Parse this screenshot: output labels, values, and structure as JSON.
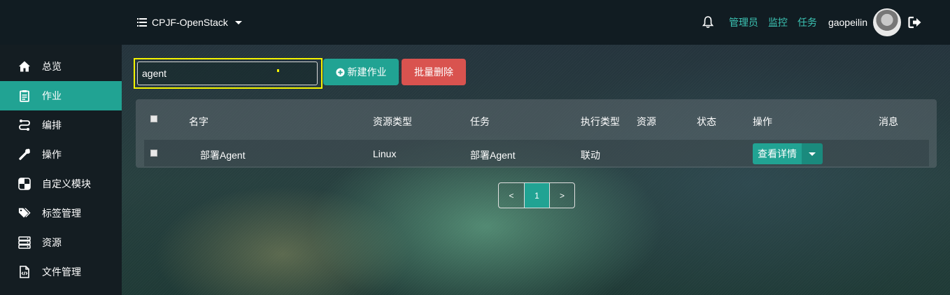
{
  "header": {
    "project_name": "CPJF-OpenStack",
    "links": [
      "管理员",
      "监控",
      "任务"
    ],
    "username": "gaopeilin",
    "accent": "#21a393",
    "link_color": "#3cc4b4"
  },
  "sidebar": {
    "items": [
      {
        "label": "总览",
        "icon": "home-icon"
      },
      {
        "label": "作业",
        "icon": "clipboard-icon",
        "active": true
      },
      {
        "label": "编排",
        "icon": "flow-icon"
      },
      {
        "label": "操作",
        "icon": "wrench-icon"
      },
      {
        "label": "自定义模块",
        "icon": "puzzle-icon"
      },
      {
        "label": "标签管理",
        "icon": "tags-icon"
      },
      {
        "label": "资源",
        "icon": "server-icon"
      },
      {
        "label": "文件管理",
        "icon": "file-code-icon"
      }
    ]
  },
  "toolbar": {
    "search_value": "agent",
    "new_job_label": "新建作业",
    "batch_delete_label": "批量删除",
    "delete_color": "#d9534f"
  },
  "table": {
    "columns": [
      "名字",
      "资源类型",
      "任务",
      "执行类型",
      "资源",
      "状态",
      "操作",
      "消息"
    ],
    "rows": [
      {
        "name": "部署Agent",
        "resource_type": "Linux",
        "task": "部署Agent",
        "exec_type": "联动",
        "resource": "",
        "status": "",
        "action_label": "查看详情",
        "message": ""
      }
    ]
  },
  "pagination": {
    "prev": "<",
    "current": "1",
    "next": ">"
  }
}
